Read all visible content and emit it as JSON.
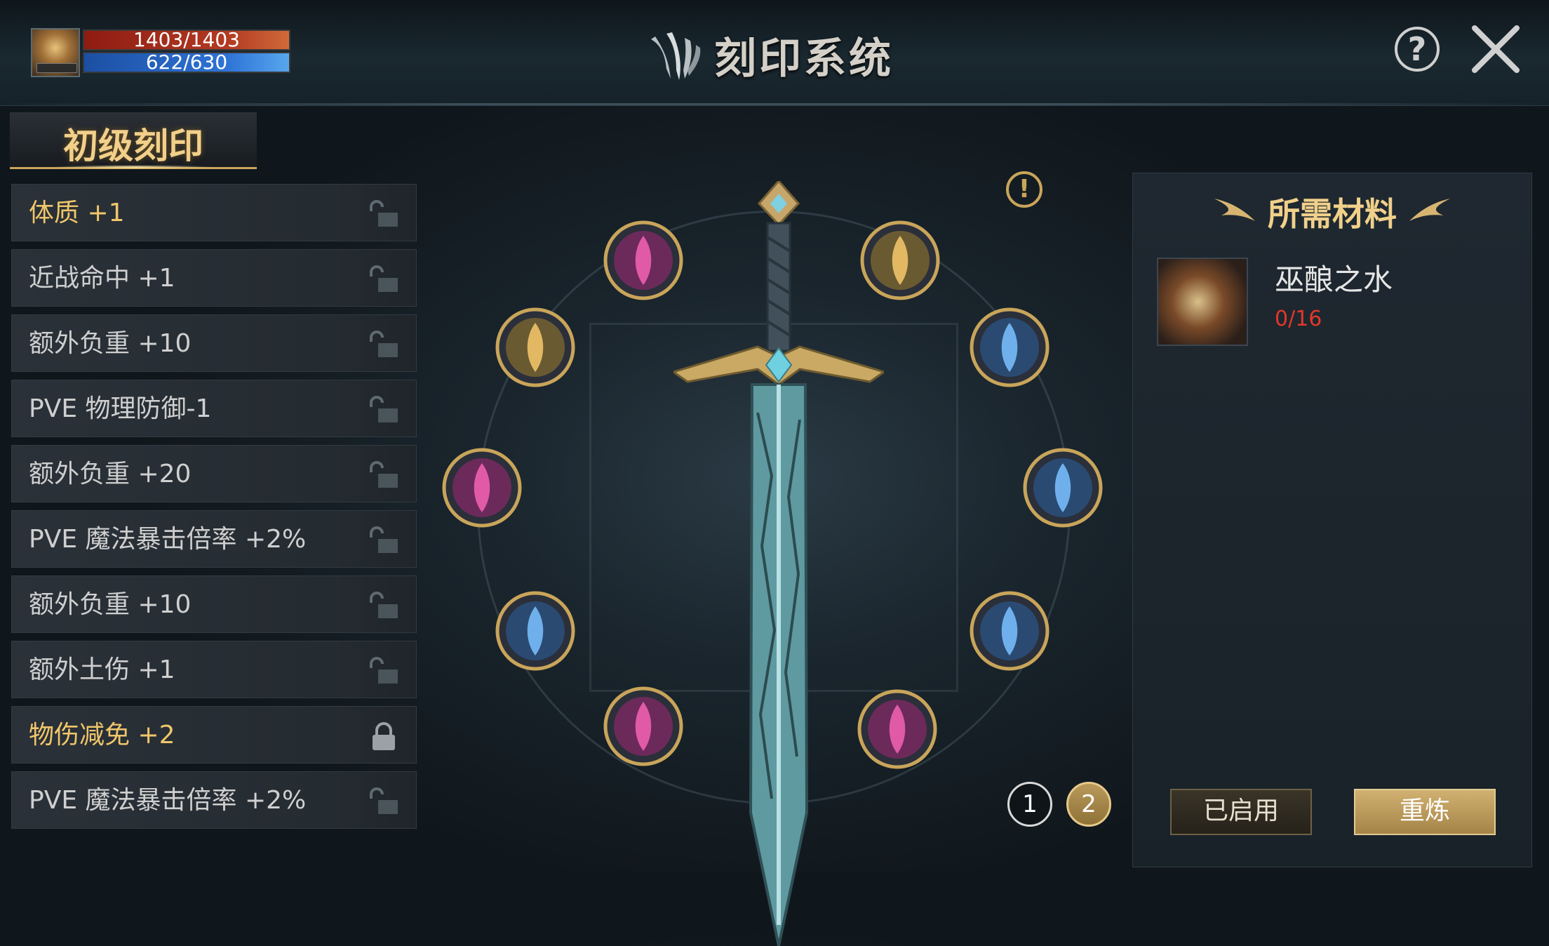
{
  "header": {
    "title": "刻印系统",
    "help_label": "?",
    "hp_text": "1403/1403",
    "mp_text": "622/630"
  },
  "sidebar": {
    "tab_label": "初级刻印",
    "items": [
      {
        "label": "体质 +1",
        "active": true,
        "locked": false
      },
      {
        "label": "近战命中 +1",
        "active": false,
        "locked": false
      },
      {
        "label": "额外负重 +10",
        "active": false,
        "locked": false
      },
      {
        "label": "PVE 物理防御-1",
        "active": false,
        "locked": false
      },
      {
        "label": "额外负重 +20",
        "active": false,
        "locked": false
      },
      {
        "label": "PVE 魔法暴击倍率 +2%",
        "active": false,
        "locked": false
      },
      {
        "label": "额外负重 +10",
        "active": false,
        "locked": false
      },
      {
        "label": "额外土伤 +1",
        "active": false,
        "locked": false
      },
      {
        "label": "物伤减免 +2",
        "active": true,
        "locked": true
      },
      {
        "label": "PVE 魔法暴击倍率 +2%",
        "active": false,
        "locked": false
      }
    ]
  },
  "center": {
    "alert_label": "!",
    "pages": [
      "1",
      "2"
    ],
    "current_page": "2",
    "runes": [
      "pink",
      "gold",
      "gold",
      "blue",
      "pink",
      "blue",
      "blue",
      "blue",
      "pink",
      "pink"
    ]
  },
  "materials": {
    "title": "所需材料",
    "item_name": "巫酿之水",
    "item_count": "0/16"
  },
  "buttons": {
    "enabled_label": "已启用",
    "refine_label": "重炼"
  },
  "colors": {
    "accent_gold": "#f0d08a",
    "active_text": "#f0c66a",
    "count_red": "#e3372b"
  }
}
